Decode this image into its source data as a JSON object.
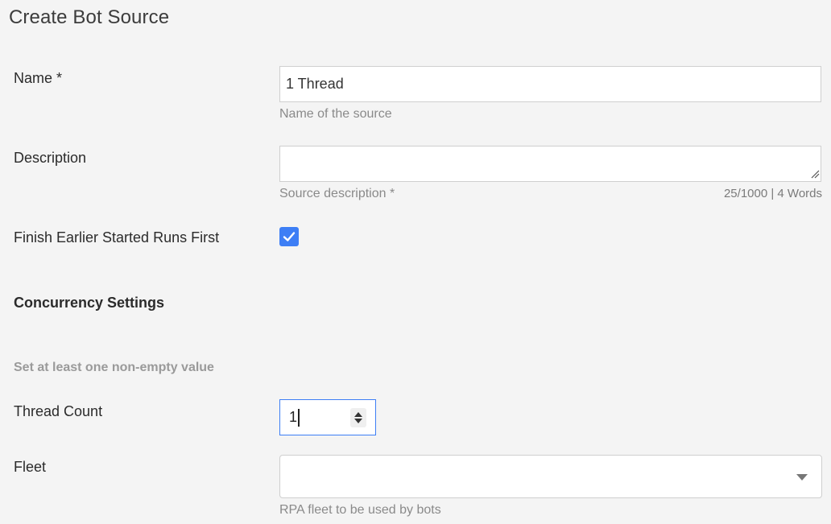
{
  "page": {
    "title": "Create Bot Source"
  },
  "form": {
    "name": {
      "label": "Name *",
      "value": "1 Thread",
      "hint": "Name of the source"
    },
    "description": {
      "label": "Description",
      "value": "",
      "hint": "Source description *",
      "counter": "25/1000 | 4 Words"
    },
    "finish_earlier": {
      "label": "Finish Earlier Started Runs First",
      "checked": true
    },
    "concurrency": {
      "heading": "Concurrency Settings",
      "hint": "Set at least one non-empty value"
    },
    "thread_count": {
      "label": "Thread Count",
      "value": "1"
    },
    "fleet": {
      "label": "Fleet",
      "value": "",
      "hint": "RPA fleet to be used by bots"
    }
  },
  "colors": {
    "accent": "#3d7ef5",
    "background": "#f4f4f4"
  },
  "icons": {
    "checkbox": "check-icon",
    "stepper": "spin-arrows-icon",
    "select": "chevron-down-icon",
    "resize": "resize-grip-icon"
  }
}
